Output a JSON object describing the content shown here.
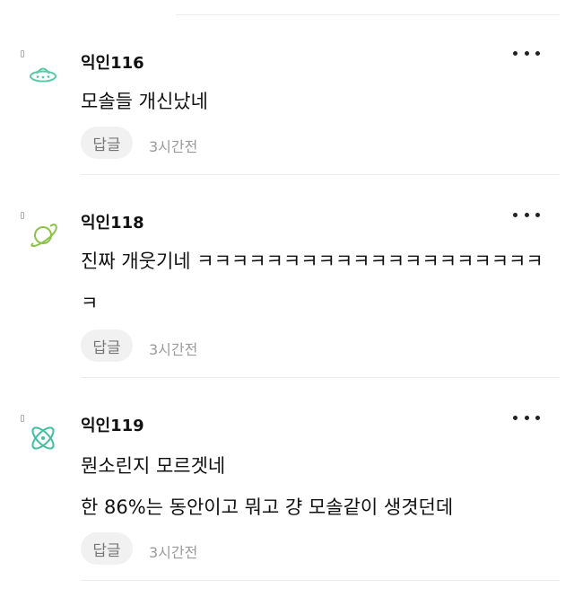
{
  "comments": [
    {
      "author": "익인116",
      "avatar_icon": "ufo-icon",
      "avatar_color": "#5cc9a7",
      "lines": [
        "모솔들 개신났네"
      ],
      "reply_label": "답글",
      "time": "3시간전"
    },
    {
      "author": "익인118",
      "avatar_icon": "planet-icon",
      "avatar_color": "#8bc34a",
      "lines": [
        "진짜 개웃기네 ㅋㅋㅋㅋㅋㅋㅋㅋㅋㅋㅋㅋㅋㅋㅋㅋㅋㅋㅋㅋ",
        "ㅋ"
      ],
      "reply_label": "답글",
      "time": "3시간전"
    },
    {
      "author": "익인119",
      "avatar_icon": "atom-icon",
      "avatar_color": "#3fbf9f",
      "lines": [
        "뭔소린지 모르겟네",
        "한 86%는 동안이고 뭐고 걍 모솔같이 생겻던데"
      ],
      "reply_label": "답글",
      "time": "3시간전"
    }
  ]
}
